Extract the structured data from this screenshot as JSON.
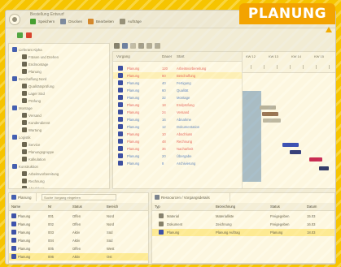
{
  "badge": "PLANUNG",
  "window": {
    "title": "Bestellung Entwurf",
    "toolbar": [
      "Speichern",
      "Drucken",
      "Bearbeiten",
      "Aufträge"
    ]
  },
  "left_tree": [
    {
      "label": "Lieferant Alpha",
      "color": "#2d52c7"
    },
    {
      "label": "Fräsen und Drehen",
      "color": "#2d52c7"
    },
    {
      "label": "Endmontage",
      "color": "#2d52c7"
    },
    {
      "label": "Planung",
      "color": "#2d52c7"
    },
    {
      "label": "Beschaffung Nord",
      "color": "#2d52c7"
    },
    {
      "label": "Qualitätsprüfung",
      "color": "#2d52c7"
    },
    {
      "label": "Lager Süd",
      "color": "#2d52c7"
    },
    {
      "label": "Prüfung",
      "color": "#2d52c7"
    },
    {
      "label": "Montage",
      "color": "#2d52c7"
    },
    {
      "label": "Versand",
      "color": "#2d52c7"
    },
    {
      "label": "Kundendienst",
      "color": "#2d52c7"
    },
    {
      "label": "Wartung",
      "color": "#2d52c7"
    },
    {
      "label": "Logistik",
      "color": "#2d52c7"
    },
    {
      "label": "Service",
      "color": "#2d52c7"
    },
    {
      "label": "Planungsgruppe",
      "color": "#2d52c7"
    },
    {
      "label": "Kalkulation",
      "color": "#2d52c7"
    },
    {
      "label": "Konstruktion",
      "color": "#2d52c7"
    },
    {
      "label": "Arbeitsvorbereitung",
      "color": "#2d52c7"
    },
    {
      "label": "Rechnung",
      "color": "#2d52c7"
    },
    {
      "label": "Abschluss",
      "color": "#2d52c7"
    }
  ],
  "grid": {
    "columns": [
      "Vorgang",
      "Dauer",
      "Start"
    ],
    "timeline": [
      "KW 12",
      "KW 13",
      "KW 14",
      "KW 15"
    ],
    "rows": [
      {
        "name": "Planung",
        "dur": "120",
        "desc": "Arbeitsvorbereitung",
        "text_color": "#e45c6a",
        "selected": false
      },
      {
        "name": "Planung",
        "dur": "80",
        "desc": "Beschaffung",
        "text_color": "#e45c6a",
        "selected": true
      },
      {
        "name": "Planung",
        "dur": "40",
        "desc": "Fertigung",
        "text_color": "#4f7fd6",
        "selected": false
      },
      {
        "name": "Planung",
        "dur": "60",
        "desc": "Qualität",
        "text_color": "#4f7fd6",
        "selected": false
      },
      {
        "name": "Planung",
        "dur": "32",
        "desc": "Montage",
        "text_color": "#4f7fd6",
        "selected": false
      },
      {
        "name": "Planung",
        "dur": "18",
        "desc": "Endprüfung",
        "text_color": "#e45c6a",
        "selected": false
      },
      {
        "name": "Planung",
        "dur": "24",
        "desc": "Versand",
        "text_color": "#e45c6a",
        "selected": false
      },
      {
        "name": "Planung",
        "dur": "16",
        "desc": "Abnahme",
        "text_color": "#4f7fd6",
        "selected": false
      },
      {
        "name": "Planung",
        "dur": "12",
        "desc": "Dokumentation",
        "text_color": "#4f7fd6",
        "selected": false
      },
      {
        "name": "Planung",
        "dur": "10",
        "desc": "Abschluss",
        "text_color": "#e45c6a",
        "selected": false
      },
      {
        "name": "Planung",
        "dur": "48",
        "desc": "Rechnung",
        "text_color": "#e45c6a",
        "selected": false
      },
      {
        "name": "Planung",
        "dur": "36",
        "desc": "Nacharbeit",
        "text_color": "#e45c6a",
        "selected": false
      },
      {
        "name": "Planung",
        "dur": "20",
        "desc": "Übergabe",
        "text_color": "#4f7fd6",
        "selected": false
      },
      {
        "name": "Planung",
        "dur": "8",
        "desc": "Archivierung",
        "text_color": "#4f7fd6",
        "selected": false
      }
    ]
  },
  "bottom_left": {
    "tab": "Planung",
    "search": "Suche Vorgang eingeben",
    "headers": [
      "Name",
      "Nr",
      "Status",
      "Bereich"
    ],
    "rows": [
      [
        "Planung",
        "001",
        "Offen",
        "Nord"
      ],
      [
        "Planung",
        "002",
        "Offen",
        "Nord"
      ],
      [
        "Planung",
        "003",
        "Aktiv",
        "Süd"
      ],
      [
        "Planung",
        "004",
        "Aktiv",
        "Süd"
      ],
      [
        "Planung",
        "005",
        "Offen",
        "West"
      ],
      [
        "Planung",
        "006",
        "Aktiv",
        "Ost"
      ]
    ]
  },
  "bottom_right": {
    "tab": "Ressourcen / Vorgangsdetails",
    "headers": [
      "Typ",
      "Bezeichnung",
      "Status",
      "Datum"
    ],
    "rows": [
      [
        "Material",
        "Materialliste",
        "Freigegeben",
        "15.03"
      ],
      [
        "Dokument",
        "Zeichnung",
        "Freigegeben",
        "16.03"
      ],
      [
        "Planung",
        "Planung Auftrag",
        "Planung",
        "18.03"
      ]
    ]
  }
}
